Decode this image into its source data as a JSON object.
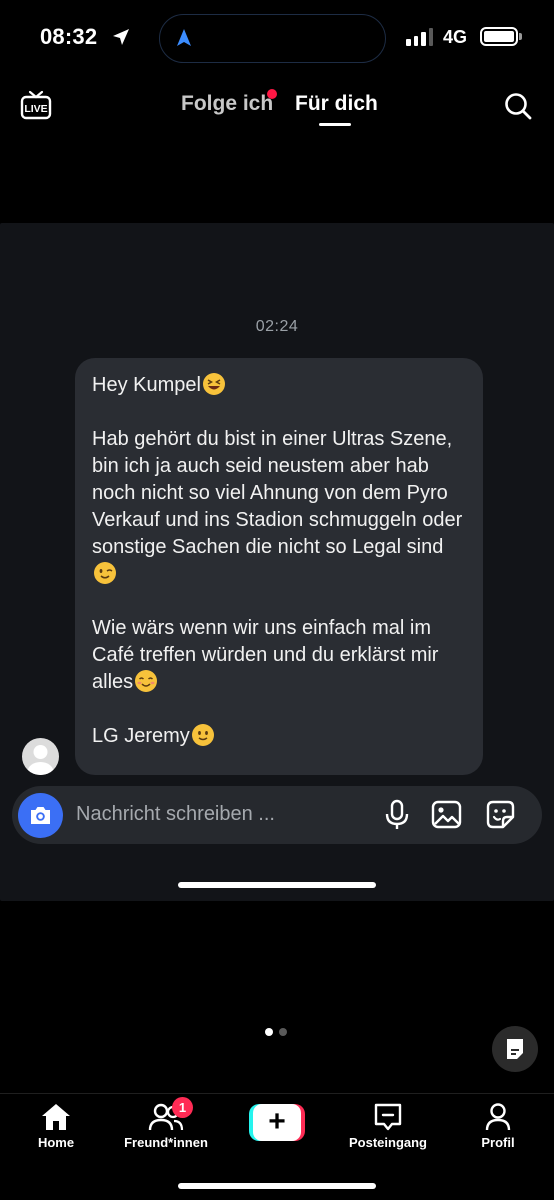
{
  "status_bar": {
    "time": "08:32",
    "network": "4G",
    "signal_bars": 3,
    "battery_level": 1.0
  },
  "top_nav": {
    "live_label": "LIVE",
    "tab_following": "Folge ich",
    "tab_for_you": "Für dich",
    "active_tab": "Für dich"
  },
  "chat": {
    "timestamp": "02:24",
    "message_paragraphs": [
      "Hey Kumpel",
      "Hab gehört du bist in einer Ultras Szene, bin ich ja auch seid neustem aber hab noch nicht so viel Ahnung von dem Pyro Verkauf und ins Stadion schmuggeln oder sonstige Sachen die nicht so Legal sind",
      "Wie wärs wenn wir uns einfach mal im Café treffen würden und du erklärst mir alles",
      "LG Jeremy"
    ],
    "emojis": [
      "laughing-emoji",
      "winking-emoji",
      "smiling-blush-emoji",
      "slight-smile-emoji"
    ],
    "composer_placeholder": "Nachricht schreiben ..."
  },
  "pager": {
    "count": 2,
    "active_index": 0
  },
  "bottom_nav": {
    "home": "Home",
    "friends": "Freund*innen",
    "friends_badge": "1",
    "inbox": "Posteingang",
    "profile": "Profil"
  },
  "colors": {
    "accent_blue": "#3b6ff5",
    "badge_red": "#ff2b55",
    "bubble_bg": "#2a2d33",
    "panel_bg": "#121418",
    "tiktok_cyan": "#25f4ee",
    "tiktok_red": "#fe2c55"
  }
}
